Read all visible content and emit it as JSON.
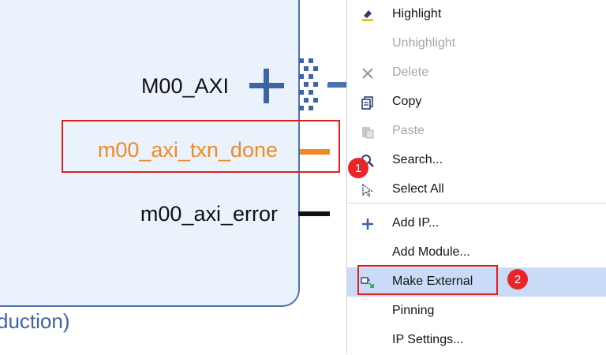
{
  "canvas": {
    "ports": {
      "m00_axi": "M00_AXI",
      "txn_done": "m00_axi_txn_done",
      "error": "m00_axi_error"
    },
    "caption": "duction)"
  },
  "badges": {
    "first": "1",
    "second": "2"
  },
  "colors": {
    "block_fill": "#eaf2fb",
    "block_border": "#4e72ad",
    "accent_blue": "#3e64a2",
    "port_orange": "#f0892a",
    "annotation_red": "#e02020",
    "menu_selected": "#c9dbf6"
  },
  "menu": {
    "items": [
      {
        "label": "Highlight",
        "icon": "highlight-icon",
        "disabled": false
      },
      {
        "label": "Unhighlight",
        "icon": "",
        "disabled": true
      },
      {
        "label": "Delete",
        "icon": "close-icon",
        "disabled": true
      },
      {
        "label": "Copy",
        "icon": "copy-icon",
        "disabled": false
      },
      {
        "label": "Paste",
        "icon": "paste-icon",
        "disabled": true
      },
      {
        "label": "Search...",
        "icon": "search-icon",
        "disabled": false
      },
      {
        "label": "Select All",
        "icon": "cursor-icon",
        "disabled": false
      },
      {
        "label": "Add IP...",
        "icon": "plus-icon",
        "disabled": false
      },
      {
        "label": "Add Module...",
        "icon": "",
        "disabled": false
      },
      {
        "label": "Make External",
        "icon": "make-external-icon",
        "disabled": false,
        "selected": true
      },
      {
        "label": "Pinning",
        "icon": "",
        "disabled": false
      },
      {
        "label": "IP Settings...",
        "icon": "",
        "disabled": false
      }
    ]
  }
}
